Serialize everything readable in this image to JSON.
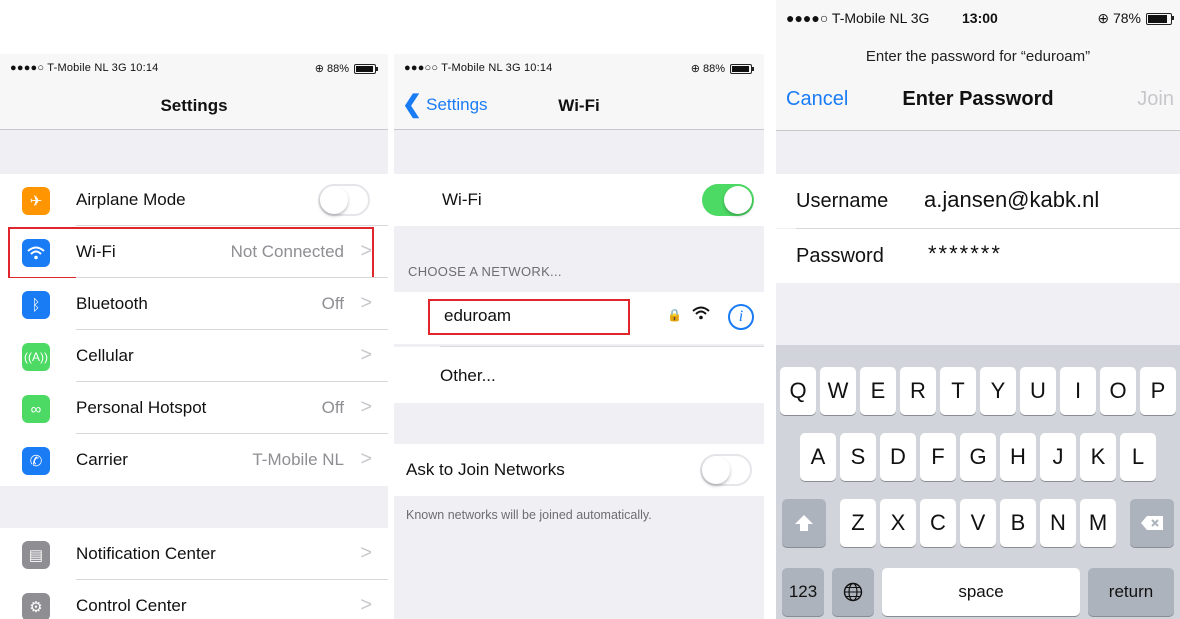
{
  "screen1": {
    "status": {
      "left": "●●●●○ T-Mobile NL  3G  10:14",
      "right": "⊕ 88%",
      "battery_level": 0.88
    },
    "title": "Settings",
    "rows": [
      {
        "label": "Airplane Mode",
        "icon": "airplane-icon",
        "color": "#ff9500",
        "toggle": "off"
      },
      {
        "label": "Wi-Fi",
        "value": "Not Connected",
        "icon": "wifi-icon",
        "color": "#1a7cf5"
      },
      {
        "label": "Bluetooth",
        "value": "Off",
        "icon": "bluetooth-icon",
        "color": "#1a7cf5"
      },
      {
        "label": "Cellular",
        "value": "",
        "icon": "cellular-icon",
        "color": "#4cd964"
      },
      {
        "label": "Personal Hotspot",
        "value": "Off",
        "icon": "hotspot-icon",
        "color": "#4cd964"
      },
      {
        "label": "Carrier",
        "value": "T-Mobile NL",
        "icon": "phone-icon",
        "color": "#1a7cf5"
      },
      {
        "label": "Notification Center",
        "value": "",
        "icon": "notification-icon",
        "color": "#8e8e93"
      },
      {
        "label": "Control Center",
        "value": "",
        "icon": "control-center-icon",
        "color": "#8e8e93"
      }
    ],
    "chevron": ">"
  },
  "screen2": {
    "status": {
      "left": "●●●○○ T-Mobile NL  3G  10:14",
      "right": "⊕ 88%",
      "battery_level": 0.88
    },
    "back_label": "Settings",
    "back_chevron": "❮",
    "title": "Wi-Fi",
    "wifi_label": "Wi-Fi",
    "wifi_toggle": "on",
    "choose_header": "CHOOSE A NETWORK...",
    "network": "eduroam",
    "lock_glyph": "🔒",
    "info_glyph": "i",
    "other": "Other...",
    "ask_label": "Ask to Join Networks",
    "ask_toggle": "off",
    "footnote": "Known networks will be joined automatically."
  },
  "screen3": {
    "status": {
      "left": "●●●●○ T-Mobile NL  3G",
      "time": "13:00",
      "right": "⊕ 78%",
      "battery_level": 0.78
    },
    "prompt": "Enter the password for “eduroam”",
    "cancel": "Cancel",
    "title": "Enter Password",
    "join": "Join",
    "username_label": "Username",
    "username_value": "a.jansen@kabk.nl",
    "password_label": "Password",
    "password_value": "*******",
    "keyboard": {
      "row1": [
        "Q",
        "W",
        "E",
        "R",
        "T",
        "Y",
        "U",
        "I",
        "O",
        "P"
      ],
      "row2": [
        "A",
        "S",
        "D",
        "F",
        "G",
        "H",
        "J",
        "K",
        "L"
      ],
      "row3": [
        "Z",
        "X",
        "C",
        "V",
        "B",
        "N",
        "M"
      ],
      "numbers": "123",
      "space": "space",
      "return": "return"
    }
  },
  "colors": {
    "accent": "#1a7cf5",
    "toggle_on": "#4cd964",
    "highlight": "#e0262d"
  }
}
